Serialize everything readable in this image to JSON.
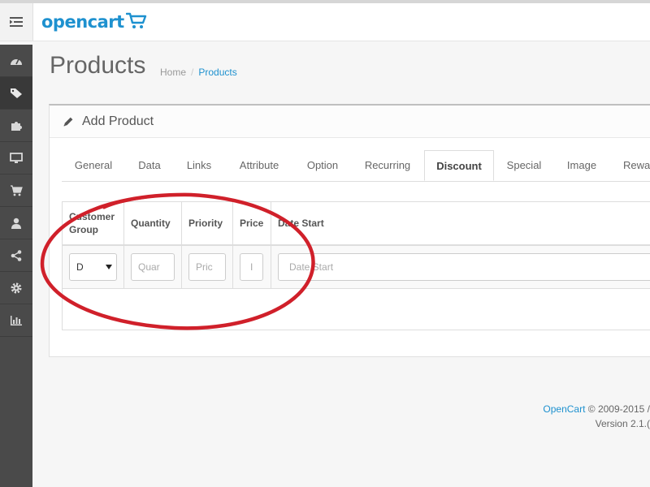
{
  "header": {
    "logo_text": "opencart"
  },
  "sidebar": {
    "items": [
      {
        "icon": "dashboard-icon"
      },
      {
        "icon": "tags-icon"
      },
      {
        "icon": "puzzle-icon"
      },
      {
        "icon": "desktop-icon"
      },
      {
        "icon": "cart-icon"
      },
      {
        "icon": "user-icon"
      },
      {
        "icon": "share-icon"
      },
      {
        "icon": "gear-icon"
      },
      {
        "icon": "bar-chart-icon"
      }
    ]
  },
  "page": {
    "title": "Products",
    "breadcrumb": {
      "home": "Home",
      "separator": "/",
      "current": "Products"
    }
  },
  "panel": {
    "title": "Add Product"
  },
  "tabs": [
    "General",
    "Data",
    "Links",
    "Attribute",
    "Option",
    "Recurring",
    "Discount",
    "Special",
    "Image",
    "Rewar"
  ],
  "active_tab": "Discount",
  "table": {
    "headers": {
      "customer_group": "Customer\nGroup",
      "customer_group_line1": "Customer",
      "customer_group_line2": "Group",
      "quantity": "Quantity",
      "priority": "Priority",
      "price": "Price",
      "date_start": "Date Start"
    },
    "row": {
      "customer_group_value": "D",
      "quantity_placeholder": "Quar",
      "priority_placeholder": "Pric",
      "price_placeholder": "I",
      "date_start_placeholder": "Date Start"
    }
  },
  "footer": {
    "link": "OpenCart",
    "copyright": "© 2009-2015 /",
    "version": "Version 2.1.("
  },
  "colors": {
    "brand": "#1e91cf",
    "annotation": "#d0202a",
    "sidebar": "#4a4a4a"
  }
}
